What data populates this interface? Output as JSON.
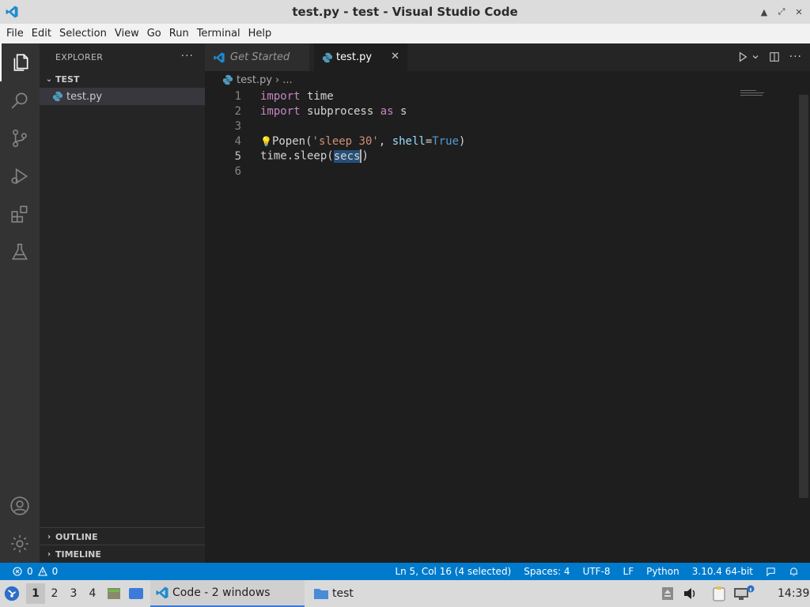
{
  "window": {
    "title": "test.py - test - Visual Studio Code",
    "minimize": "▲",
    "maximize": "⤢",
    "close": "✕"
  },
  "menu": [
    "File",
    "Edit",
    "Selection",
    "View",
    "Go",
    "Run",
    "Terminal",
    "Help"
  ],
  "sidebar": {
    "header": "EXPLORER",
    "more": "···",
    "folder": "TEST",
    "file": "test.py",
    "outline": "OUTLINE",
    "timeline": "TIMELINE"
  },
  "tabs": {
    "get_started": "Get Started",
    "active": "test.py",
    "close": "✕"
  },
  "breadcrumb": {
    "file": "test.py",
    "sep": "›",
    "rest": "..."
  },
  "editor": {
    "line_numbers": [
      "1",
      "2",
      "3",
      "4",
      "5",
      "6"
    ],
    "line1": {
      "kw": "import",
      "rest": " time"
    },
    "line2": {
      "kw": "import",
      "mid": " subprocess ",
      "kw2": "as",
      "rest": " s"
    },
    "line4": {
      "call": "Popen(",
      "str": "'sleep 30'",
      "comma": ", ",
      "param": "shell",
      "eq": "=",
      "const": "True",
      "close": ")"
    },
    "line5": {
      "call": "time.sleep(",
      "sel": "secs",
      "close": ")"
    }
  },
  "status": {
    "errors": "0",
    "warnings": "0",
    "position": "Ln 5, Col 16 (4 selected)",
    "spaces": "Spaces: 4",
    "encoding": "UTF-8",
    "eol": "LF",
    "language": "Python",
    "interpreter": "3.10.4 64-bit"
  },
  "taskbar": {
    "workspaces": [
      "1",
      "2",
      "3",
      "4"
    ],
    "code_task": "Code - 2 windows",
    "folder_task": "test",
    "clock": "14:39"
  },
  "colors": {
    "accent": "#007acc",
    "editor_bg": "#1e1e1e",
    "sidebar_bg": "#252526",
    "activity_bg": "#333333",
    "keyword": "#c586c0",
    "string": "#ce9178",
    "constant": "#569cd6",
    "parameter": "#9cdcfe"
  }
}
